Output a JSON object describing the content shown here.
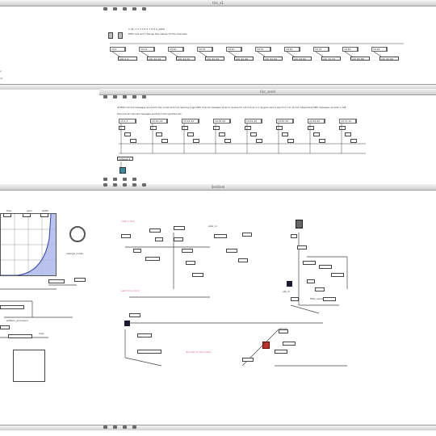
{
  "windows": {
    "top": {
      "title": "ticc_s1"
    },
    "middle": {
      "title": "ticc_send"
    },
    "bottom": {
      "title": "Sentinel"
    }
  },
  "top_comments": {
    "line1": "1 ab_1 2 3 4 5 6 7 8 9 a_slider",
    "line2": "MIDI unit and change the values of the channels"
  },
  "top_objects": [
    "ctrl_1 1",
    "ctrl_11 12",
    "ctrl_21 22",
    "ctrl_31 32",
    "ctrl_41 42",
    "ctrl_51 52",
    "ctrl_61 62",
    "ctrl_71 72",
    "ctrl_81 82",
    "ctrl_91 92"
  ],
  "top_messages": [
    "ctl 1",
    "ctl 11",
    "ctl 21",
    "ctl 31",
    "ctl 41",
    "ctl 51",
    "ctl 61",
    "ctl 71",
    "ctl 81",
    "ctl 91"
  ],
  "middle_comment": {
    "line1": "All MIDI unit and messages are sent to the current slot only. Sending single MIDI channel messages stops to receive it's not sure as in a range to send a key from 1 to 15 and independent MIDI messages, as slots in 128",
    "line2": "there are all channels messages sending to the specified slot."
  },
  "middle_objects": [
    "ctl 1 2",
    "ctl 11 12",
    "ctl 21 22",
    "ctl 31 32",
    "ctl 41 42",
    "ctl 51 52",
    "ctl 61 62",
    "ctl 71 72"
  ],
  "middle_bottom_object": "noteout 1",
  "bottom_labels": {
    "freq": "freq",
    "gain": "gain",
    "width": "width",
    "change_mode": "change_mode",
    "audio_out": "pattern_processor",
    "loop": "loop",
    "filter_send": "filter_send",
    "sample": "sample",
    "set_in": "set_in",
    "adsr_in": "adsr_in",
    "pink_note1": "note 1 freq",
    "pink_note2": "send to a clock",
    "pink_note3": "the info on the mixer"
  },
  "left_partial": {
    "line1": "v",
    "line2": "ct"
  },
  "colors": {
    "blue_fill": "#a8b4e8",
    "dark_square": "#1a1a33",
    "red_square": "#c0302c",
    "teal_square": "#3a8a9a",
    "pink_text": "#e05a8a"
  },
  "icons": [
    "window-icon",
    "lock-icon",
    "patcher-icon",
    "run-icon",
    "edit-icon"
  ]
}
